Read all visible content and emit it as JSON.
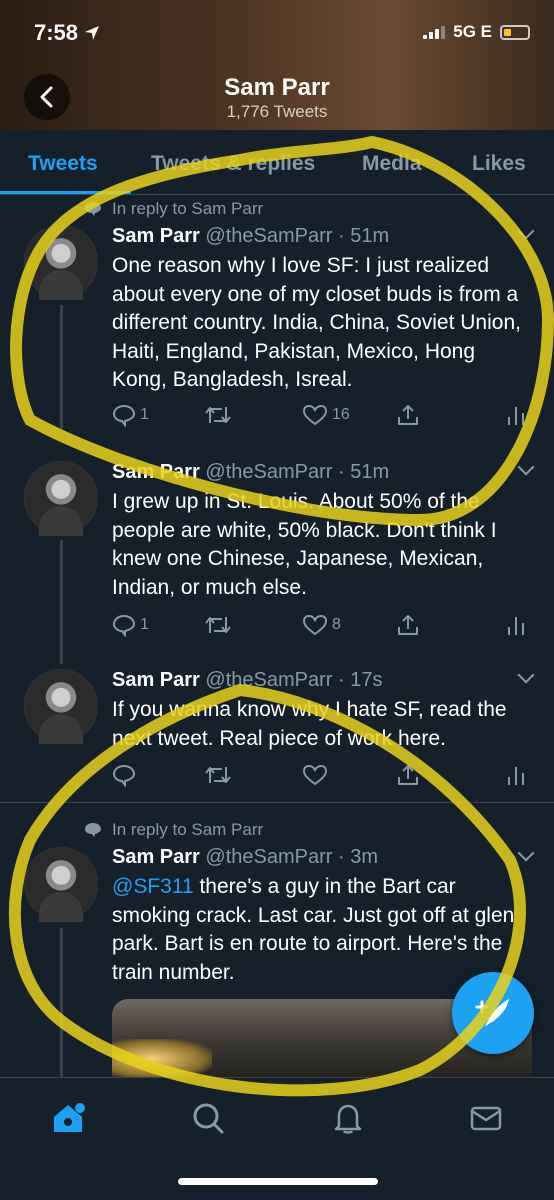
{
  "status_bar": {
    "time": "7:58",
    "network": "5G E"
  },
  "header": {
    "title": "Sam Parr",
    "subtitle": "1,776 Tweets"
  },
  "tabs": [
    {
      "label": "Tweets",
      "active": true
    },
    {
      "label": "Tweets & replies",
      "active": false
    },
    {
      "label": "Media",
      "active": false
    },
    {
      "label": "Likes",
      "active": false
    }
  ],
  "tweets": [
    {
      "reply_context": "In reply to Sam Parr",
      "name": "Sam Parr",
      "meta": "@theSamParr · 51m",
      "text": "One reason why I love SF: I just realized about every one of my closet buds is from a different country. India, China, Soviet Union, Haiti, England, Pakistan, Mexico, Hong Kong, Bangladesh, Isreal.",
      "replies": "1",
      "retweets": "",
      "likes": "16"
    },
    {
      "name": "Sam Parr",
      "meta": "@theSamParr · 51m",
      "text": "I grew up in St. Louis. About 50% of the people are white, 50% black. Don't think I knew one Chinese, Japanese, Mexican, Indian, or much else.",
      "replies": "1",
      "retweets": "",
      "likes": "8"
    },
    {
      "name": "Sam Parr",
      "meta": "@theSamParr · 17s",
      "text": "If you wanna know why I hate SF, read the next tweet. Real piece of work here.",
      "replies": "",
      "retweets": "",
      "likes": ""
    },
    {
      "reply_context": "In reply to Sam Parr",
      "name": "Sam Parr",
      "meta": "@theSamParr · 3m",
      "mention": "@SF311",
      "text": " there's a guy in the Bart car smoking crack. Last car. Just got off at glen park. Bart is en route to airport. Here's the train number."
    }
  ],
  "colors": {
    "accent": "#1da1f2",
    "background": "#15202b",
    "muted": "#8899a6",
    "highlighter": "#e8d21a"
  },
  "icons": [
    "back-arrow-icon",
    "reply-icon",
    "retweet-icon",
    "like-icon",
    "share-icon",
    "analytics-icon",
    "compose-icon",
    "home-icon",
    "search-icon",
    "notifications-icon",
    "messages-icon"
  ]
}
